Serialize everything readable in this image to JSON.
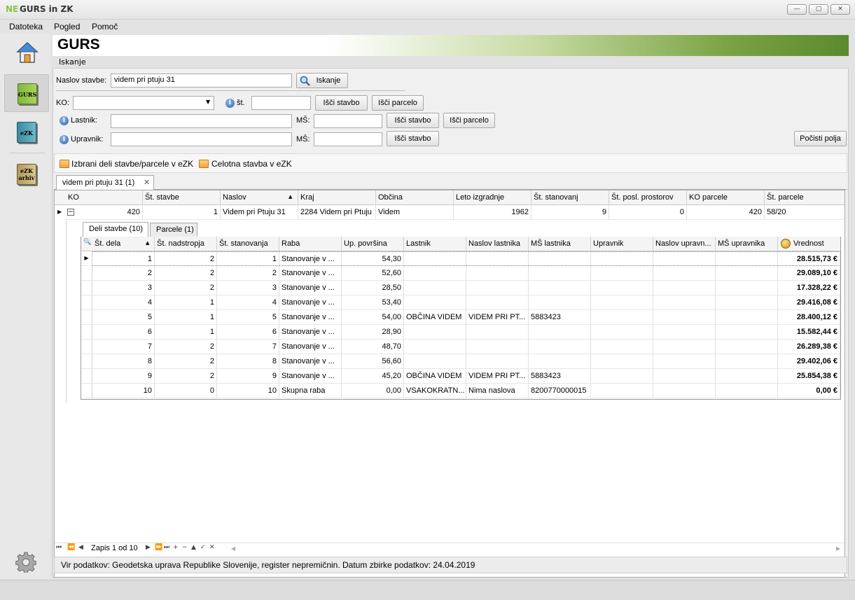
{
  "window": {
    "logo": "NE",
    "title": "GURS in ZK",
    "minimize": "—",
    "maximize": "▢",
    "close": "✕"
  },
  "menu": [
    "Datoteka",
    "Pogled",
    "Pomoč"
  ],
  "sidebar": {
    "gurs": "GURS",
    "ezk": "eZK",
    "ezk_archive_line1": "eZK",
    "ezk_archive_line2": "arhiv"
  },
  "header": {
    "title": "GURS"
  },
  "section": {
    "label": "Iskanje"
  },
  "search": {
    "address_label": "Naslov stavbe:",
    "address_value": "videm pri ptuju 31",
    "search_button": "Iskanje",
    "ko_label": "KO:",
    "ko_value": "",
    "st_label": "št.",
    "st_value": "",
    "find_building": "Išči stavbo",
    "find_parcel": "Išči parcelo",
    "owner_label": "Lastnik:",
    "owner_value": "",
    "ms_label": "MŠ:",
    "owner_ms_value": "",
    "owner_find_building": "Išči stavbo",
    "owner_find_parcel": "Išči parcelo",
    "manager_label": "Upravnik:",
    "manager_value": "",
    "manager_ms_value": "",
    "manager_find_building": "Išči stavbo",
    "clear_fields": "Počisti polja"
  },
  "actions": {
    "selected_parts": "Izbrani deli stavbe/parcele v eZK",
    "whole_building": "Celotna stavba v eZK"
  },
  "result_tab": {
    "label": "videm pri ptuju 31 (1)",
    "close": "✕"
  },
  "main_grid": {
    "columns": [
      "KO",
      "Št. stavbe",
      "Naslov",
      "Kraj",
      "Občina",
      "Leto izgradnje",
      "Št. stanovanj",
      "Št. posl. prostorov",
      "KO parcele",
      "Št. parcele"
    ],
    "row": [
      "420",
      "1",
      "Videm pri Ptuju 31",
      "2284 Videm pri Ptuju",
      "Videm",
      "1962",
      "9",
      "0",
      "420",
      "58/20"
    ]
  },
  "detail_tabs": [
    "Deli stavbe (10)",
    "Parcele (1)"
  ],
  "detail_grid": {
    "columns": [
      "Št. dela",
      "Št. nadstropja",
      "Št. stanovanja",
      "Raba",
      "Up. površina",
      "Lastnik",
      "Naslov lastnika",
      "MŠ lastnika",
      "Upravnik",
      "Naslov upravn...",
      "MŠ upravnika",
      "Vrednost"
    ],
    "rows": [
      [
        "1",
        "2",
        "1",
        "Stanovanje v ...",
        "54,30",
        "",
        "",
        "",
        "",
        "",
        "",
        "28.515,73 €"
      ],
      [
        "2",
        "2",
        "2",
        "Stanovanje v ...",
        "52,60",
        "",
        "",
        "",
        "",
        "",
        "",
        "29.089,10 €"
      ],
      [
        "3",
        "2",
        "3",
        "Stanovanje v ...",
        "28,50",
        "",
        "",
        "",
        "",
        "",
        "",
        "17.328,22 €"
      ],
      [
        "4",
        "1",
        "4",
        "Stanovanje v ...",
        "53,40",
        "",
        "",
        "",
        "",
        "",
        "",
        "29.416,08 €"
      ],
      [
        "5",
        "1",
        "5",
        "Stanovanje v ...",
        "54,00",
        "OBČINA VIDEM",
        "VIDEM PRI PT...",
        "5883423",
        "",
        "",
        "",
        "28.400,12 €"
      ],
      [
        "6",
        "1",
        "6",
        "Stanovanje v ...",
        "28,90",
        "",
        "",
        "",
        "",
        "",
        "",
        "15.582,44 €"
      ],
      [
        "7",
        "2",
        "7",
        "Stanovanje v ...",
        "48,70",
        "",
        "",
        "",
        "",
        "",
        "",
        "26.289,38 €"
      ],
      [
        "8",
        "2",
        "8",
        "Stanovanje v ...",
        "56,60",
        "",
        "",
        "",
        "",
        "",
        "",
        "29.402,06 €"
      ],
      [
        "9",
        "2",
        "9",
        "Stanovanje v ...",
        "45,20",
        "OBČINA VIDEM",
        "VIDEM PRI PT...",
        "5883423",
        "",
        "",
        "",
        "25.854,38 €"
      ],
      [
        "10",
        "0",
        "10",
        "Skupna raba",
        "0,00",
        "VSAKOKRATN...",
        "Nima naslova",
        "8200770000015",
        "",
        "",
        "",
        "0,00 €"
      ]
    ]
  },
  "navigator": {
    "record": "Zapis 1 od 10",
    "buttons": [
      "⏮",
      "⏪",
      "◀",
      "▶",
      "⏩",
      "⏭",
      "+",
      "−",
      "▲",
      "✓",
      "✕"
    ]
  },
  "status": {
    "source": "Vir podatkov: Geodetska uprava Republike Slovenije, register nepremičnin. Datum zbirke podatkov: 24.04.2019"
  }
}
